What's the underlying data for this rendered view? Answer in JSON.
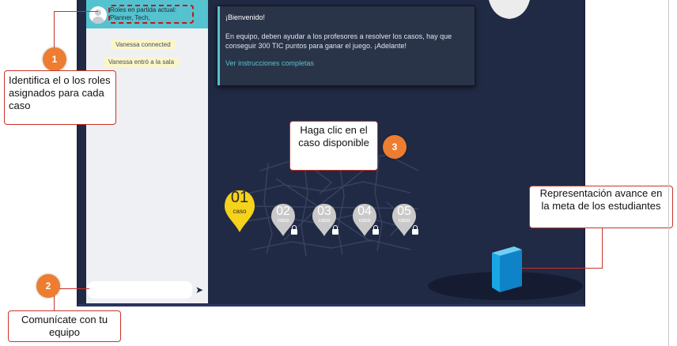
{
  "chat": {
    "roles_label": "Roles en partida actual:",
    "roles_value": "Planner, Tech,",
    "messages": [
      "Vanessa connected",
      "Vanessa entró a la sala"
    ],
    "input_placeholder": "",
    "send_icon": "send-arrow-icon"
  },
  "welcome": {
    "title": "¡Bienvenido!",
    "body": "En equipo, deben ayudar a los profesores a resolver los casos, hay que conseguir 300 TIC puntos para ganar el juego. ¡Adelante!",
    "link": "Ver instrucciones completas"
  },
  "cases": [
    {
      "number": "01",
      "label": "caso",
      "status": "available"
    },
    {
      "number": "02",
      "label": "caso",
      "status": "locked"
    },
    {
      "number": "03",
      "label": "caso",
      "status": "locked"
    },
    {
      "number": "04",
      "label": "caso",
      "status": "locked"
    },
    {
      "number": "05",
      "label": "caso",
      "status": "locked"
    }
  ],
  "annotations": [
    {
      "badge": "1",
      "text": "Identifica el o los roles asignados para cada caso"
    },
    {
      "badge": "2",
      "text": "Comunícate con tu equipo"
    },
    {
      "badge": "3",
      "text": "Haga clic en el caso disponible"
    },
    {
      "badge": "",
      "text": "Representación avance en la meta de los estudiantes"
    }
  ],
  "colors": {
    "background": "#212a44",
    "accent": "#55c3cf",
    "available_pin": "#f5d21b",
    "locked_pin": "#c9c9c9",
    "badge": "#ed7d31",
    "callout_border": "#c8342a",
    "progress_cube": "#1e9fe0"
  }
}
